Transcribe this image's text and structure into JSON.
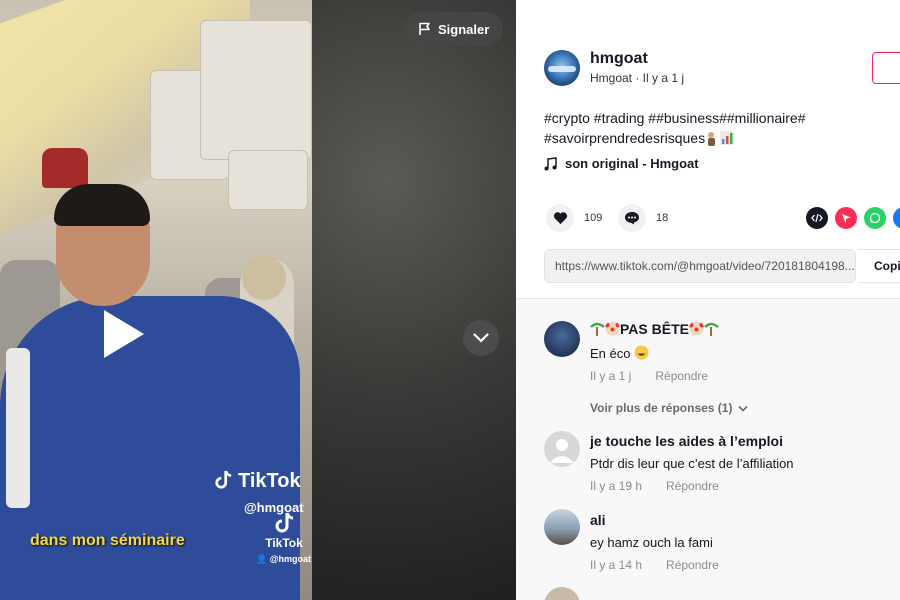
{
  "video": {
    "report_label": "Signaler",
    "watermark_brand": "TikTok",
    "watermark_handle": "@hmgoat",
    "watermark_small_brand": "TikTok",
    "watermark_small_handle": "@hmgoat",
    "caption": "dans mon séminaire"
  },
  "post": {
    "author_name": "hmgoat",
    "author_sub": "Hmgoat · Il y a 1 j",
    "description_line1": "#crypto #trading ##business##millionaire#",
    "description_line2": "#savoirprendredesrisques",
    "music": "son original - Hmgoat",
    "likes": "109",
    "comments": "18",
    "url": "https://www.tiktok.com/@hmgoat/video/720181804198...",
    "copy_label": "Copi"
  },
  "comments": [
    {
      "name": "PAS BÊTE",
      "text": "En éco",
      "time": "Il y a 1 j",
      "reply": "Répondre"
    },
    {
      "name": "je touche les aides à l’emploi",
      "text": "Ptdr dis leur que c’est de l’affiliation",
      "time": "Il y a 19 h",
      "reply": "Répondre"
    },
    {
      "name": "ali",
      "text": "ey hamz ouch la fami",
      "time": "Il y a 14 h",
      "reply": "Répondre"
    }
  ],
  "more_replies": "Voir plus de réponses (1)",
  "colors": {
    "accent": "#fe2c55",
    "caption": "#f4d840",
    "whatsapp": "#25d366",
    "facebook": "#1877f2"
  }
}
